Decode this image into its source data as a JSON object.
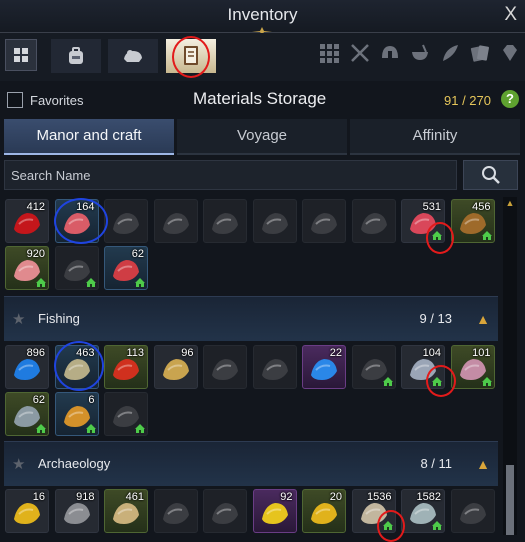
{
  "window": {
    "title": "Inventory",
    "close_label": "X"
  },
  "toolbar": {
    "categories_icon": "grid-icon",
    "left_tabs": [
      "backpack-icon",
      "pet-icon",
      "book-icon"
    ],
    "active_tab": "book-icon",
    "right_filters": [
      "grid-icon",
      "crossed-swords-icon",
      "helmet-icon",
      "bowl-icon",
      "feather-icon",
      "cards-icon",
      "gem-icon"
    ]
  },
  "storage": {
    "favorites_label": "Favorites",
    "title": "Materials Storage",
    "count": "91 / 270",
    "help_label": "?"
  },
  "tabs": [
    {
      "label": "Manor and craft",
      "active": true
    },
    {
      "label": "Voyage",
      "active": false
    },
    {
      "label": "Affinity",
      "active": false
    }
  ],
  "search": {
    "placeholder": "Search Name"
  },
  "grid_rows": [
    [
      {
        "qty": "412",
        "color": "#c4161b",
        "icon": "red-dust-icon",
        "rarity": ""
      },
      {
        "qty": "164",
        "color": "#d95c67",
        "icon": "meat-icon",
        "rarity": "blue"
      },
      {
        "qty": "",
        "color": "#3b3d42",
        "icon": "stone-icon",
        "rarity": "dim"
      },
      {
        "qty": "",
        "color": "#3b3d42",
        "icon": "planks-icon",
        "rarity": "dim"
      },
      {
        "qty": "",
        "color": "#3b3d42",
        "icon": "meat-icon",
        "rarity": "dim"
      },
      {
        "qty": "",
        "color": "#3b3d42",
        "icon": "meat-icon",
        "rarity": "dim"
      },
      {
        "qty": "",
        "color": "#3b3d42",
        "icon": "stone-icon",
        "rarity": "dim"
      },
      {
        "qty": "",
        "color": "#3b3d42",
        "icon": "dust-pile-icon",
        "rarity": "dim"
      },
      {
        "qty": "531",
        "color": "#d9475a",
        "icon": "meat-icon",
        "rarity": "",
        "house": true
      },
      {
        "qty": "456",
        "color": "#9e6a2a",
        "icon": "hide-icon",
        "rarity": "green",
        "house": true
      }
    ],
    [
      {
        "qty": "920",
        "color": "#e08a8e",
        "icon": "steak-icon",
        "rarity": "green",
        "house": true
      },
      {
        "qty": "",
        "color": "#3b3d42",
        "icon": "stone-icon",
        "rarity": "dim",
        "house": true
      },
      {
        "qty": "62",
        "color": "#cf3d44",
        "icon": "steak-icon",
        "rarity": "blue",
        "house": true
      }
    ],
    [
      {
        "qty": "896",
        "color": "#1f7be0",
        "icon": "blue-dust-icon",
        "rarity": ""
      },
      {
        "qty": "463",
        "color": "#b6ad86",
        "icon": "fish-icon",
        "rarity": "blue"
      },
      {
        "qty": "113",
        "color": "#d0301e",
        "icon": "crab-icon",
        "rarity": "green"
      },
      {
        "qty": "96",
        "color": "#c9a44f",
        "icon": "pearl-icon",
        "rarity": ""
      },
      {
        "qty": "",
        "color": "#3b3d42",
        "icon": "fish-icon",
        "rarity": "dim"
      },
      {
        "qty": "",
        "color": "#3b3d42",
        "icon": "crab-icon",
        "rarity": "dim"
      },
      {
        "qty": "22",
        "color": "#2a87e8",
        "icon": "gem-icon",
        "rarity": "purple"
      },
      {
        "qty": "",
        "color": "#3b3d42",
        "icon": "dust-pile-icon",
        "rarity": "dim",
        "house": true
      },
      {
        "qty": "104",
        "color": "#9aa5b6",
        "icon": "shell-icon",
        "rarity": "",
        "house": true
      },
      {
        "qty": "101",
        "color": "#c48ca5",
        "icon": "oyster-icon",
        "rarity": "green",
        "house": true
      }
    ],
    [
      {
        "qty": "62",
        "color": "#8b9aa3",
        "icon": "fish-icon",
        "rarity": "green",
        "house": true
      },
      {
        "qty": "6",
        "color": "#d4912a",
        "icon": "goldfish-icon",
        "rarity": "blue",
        "house": true
      },
      {
        "qty": "",
        "color": "#3b3d42",
        "icon": "crab-icon",
        "rarity": "dim",
        "house": true
      }
    ],
    [
      {
        "qty": "16",
        "color": "#e0b21c",
        "icon": "gold-dust-icon",
        "rarity": ""
      },
      {
        "qty": "918",
        "color": "#8b8d92",
        "icon": "rubble-icon",
        "rarity": ""
      },
      {
        "qty": "461",
        "color": "#c9b07a",
        "icon": "relic-icon",
        "rarity": "green"
      },
      {
        "qty": "",
        "color": "#3b3d42",
        "icon": "stone-icon",
        "rarity": "dim"
      },
      {
        "qty": "",
        "color": "#3b3d42",
        "icon": "stone-icon",
        "rarity": "dim"
      },
      {
        "qty": "92",
        "color": "#e6c41e",
        "icon": "gold-orb-icon",
        "rarity": "purple"
      },
      {
        "qty": "20",
        "color": "#e0b21c",
        "icon": "gold-dust-icon",
        "rarity": "green"
      },
      {
        "qty": "1536",
        "color": "#c2b69e",
        "icon": "fossil-icon",
        "rarity": "",
        "house": true
      },
      {
        "qty": "1582",
        "color": "#9fb2b6",
        "icon": "tablet-icon",
        "rarity": "",
        "house": true
      },
      {
        "qty": "",
        "color": "#3b3d42",
        "icon": "stone-icon",
        "rarity": "dim"
      }
    ]
  ],
  "sections": [
    {
      "name": "Fishing",
      "count": "9 / 13"
    },
    {
      "name": "Archaeology",
      "count": "8 / 11"
    }
  ]
}
